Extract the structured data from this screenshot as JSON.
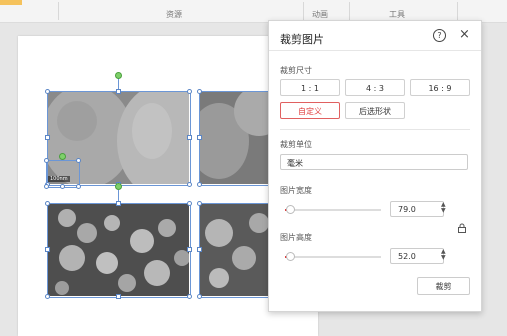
{
  "ribbon": {
    "groups": [
      "资源",
      "动画",
      "工具"
    ]
  },
  "images": {
    "scale_label": "100nm"
  },
  "panel": {
    "title": "裁剪图片",
    "help_icon": "question-icon",
    "close_icon": "close-icon",
    "crop_size": {
      "label": "裁剪尺寸",
      "ratios": [
        "1 : 1",
        "4 : 3",
        "16 : 9"
      ],
      "custom_label": "自定义",
      "after_shape_label": "后选形状"
    },
    "unit": {
      "label": "裁剪单位",
      "value": "毫米"
    },
    "width": {
      "label": "图片宽度",
      "value": "79.0",
      "slider_fraction": 0.05
    },
    "height": {
      "label": "图片高度",
      "value": "52.0",
      "slider_fraction": 0.05
    },
    "crop_button": "裁剪",
    "accent": "#e04040"
  }
}
